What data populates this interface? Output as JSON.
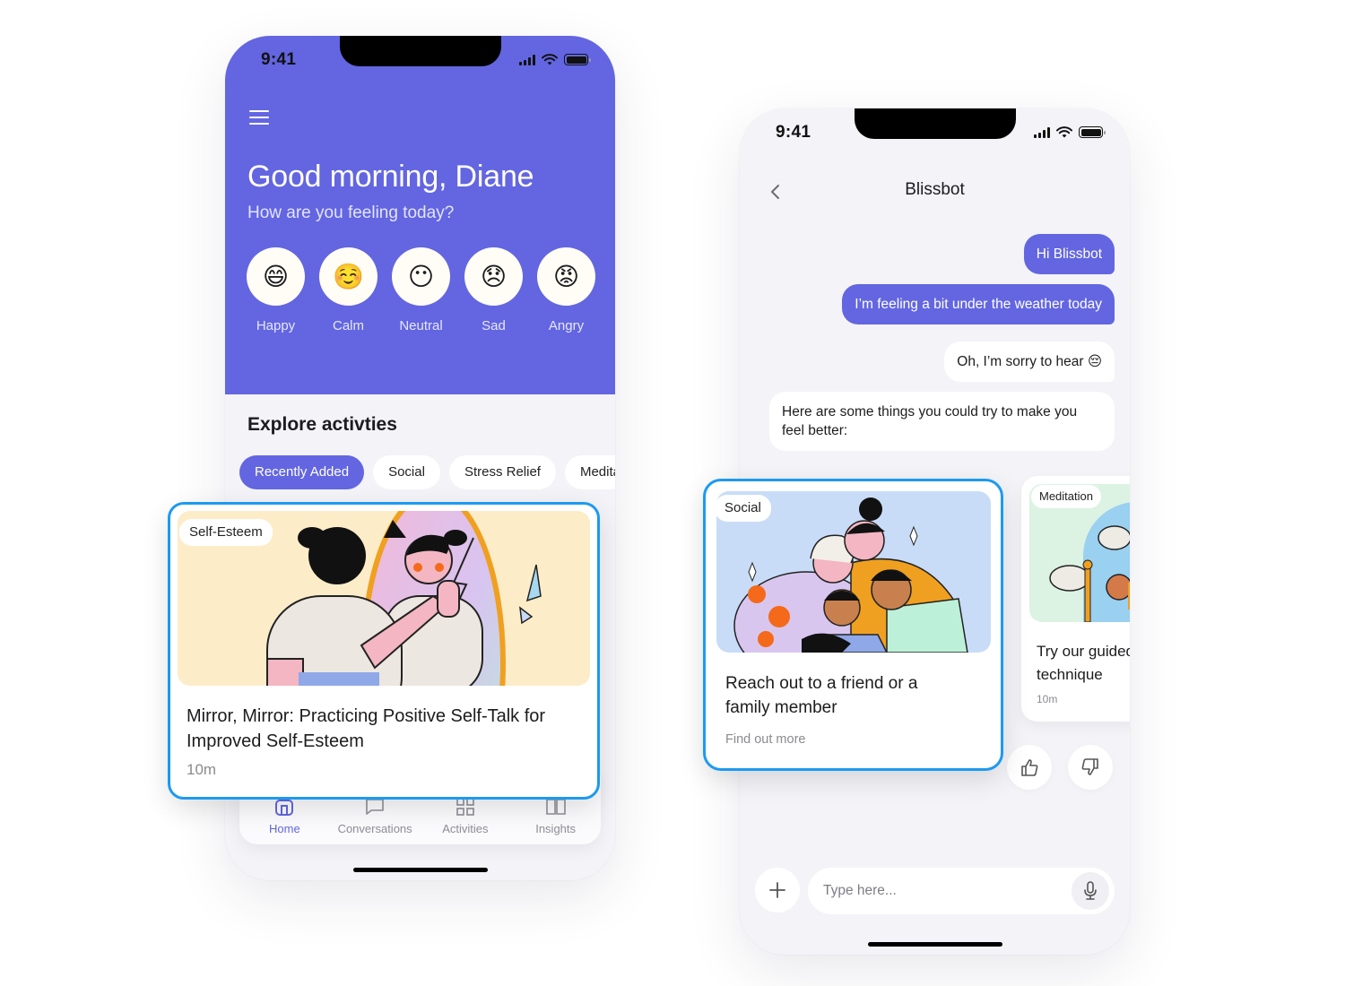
{
  "home": {
    "status_time": "9:41",
    "greeting": "Good morning, Diane",
    "subgreeting": "How are you feeling today?",
    "moods": [
      {
        "label": "Happy",
        "emoji": "😄"
      },
      {
        "label": "Calm",
        "emoji": "☺️"
      },
      {
        "label": "Neutral",
        "emoji": "😶"
      },
      {
        "label": "Sad",
        "emoji": "😞"
      },
      {
        "label": "Angry",
        "emoji": "😡"
      }
    ],
    "section_title": "Explore activties",
    "chips": [
      {
        "label": "Recently Added",
        "active": true
      },
      {
        "label": "Social",
        "active": false
      },
      {
        "label": "Stress Relief",
        "active": false
      },
      {
        "label": "Meditat",
        "active": false
      }
    ],
    "featured_card": {
      "tag": "Self-Esteem",
      "title": "Mirror, Mirror: Practicing Positive Self-Talk for Improved Self-Esteem",
      "duration": "10m",
      "illustration": "person-looking-in-mirror"
    },
    "tabs": [
      {
        "label": "Home",
        "icon": "home-icon",
        "active": true
      },
      {
        "label": "Conversations",
        "icon": "chat-bubble-icon",
        "active": false
      },
      {
        "label": "Activities",
        "icon": "grid-icon",
        "active": false
      },
      {
        "label": "Insights",
        "icon": "book-icon",
        "active": false
      }
    ]
  },
  "chat": {
    "status_time": "9:41",
    "title": "Blissbot",
    "messages": [
      {
        "from": "user",
        "text": "Hi Blissbot"
      },
      {
        "from": "user",
        "text": "I’m feeling a bit under the weather today"
      },
      {
        "from": "bot",
        "text": "Oh, I’m sorry to hear 😔"
      },
      {
        "from": "bot",
        "text": "Here are some things you could try to make you feel better:"
      }
    ],
    "suggestions": [
      {
        "tag": "Social",
        "title": "Reach out to a friend or a family member",
        "meta": "Find out more",
        "illustration": "family-group-hug"
      },
      {
        "tag": "Meditation",
        "title": "Try our guided technique",
        "meta": "10m",
        "illustration": "sleeping-person-with-sheep"
      }
    ],
    "composer": {
      "placeholder": "Type here..."
    }
  },
  "colors": {
    "brand": "#6366e0",
    "highlight": "#1c9af0",
    "background": "#f3f3f8"
  }
}
